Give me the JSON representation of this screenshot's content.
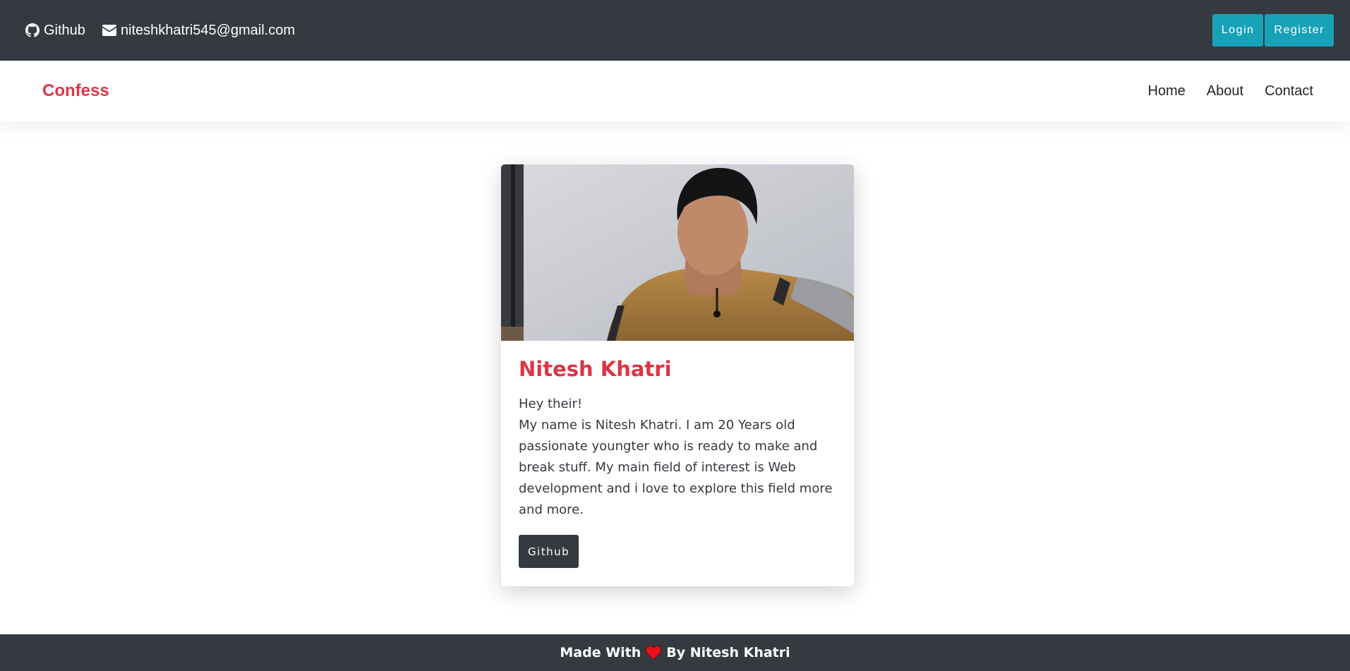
{
  "topbar": {
    "github_label": "Github",
    "email": "niteshkhatri545@gmail.com",
    "login_label": "Login",
    "register_label": "Register"
  },
  "navbar": {
    "brand": "Confess",
    "items": [
      {
        "label": "Home"
      },
      {
        "label": "About"
      },
      {
        "label": "Contact"
      }
    ]
  },
  "card": {
    "title": "Nitesh Khatri",
    "greeting": "Hey their!",
    "bio": "My name is Nitesh Khatri. I am 20 Years old passionate youngter who is ready to make and break stuff. My main field of interest is Web development and i love to explore this field more and more.",
    "button_label": "Github"
  },
  "footer": {
    "prefix": "Made With",
    "suffix": "By Nitesh Khatri",
    "heart_icon": "heart-icon"
  },
  "colors": {
    "dark": "#343a40",
    "accent": "#17a2b8",
    "brand": "#dc3545"
  }
}
